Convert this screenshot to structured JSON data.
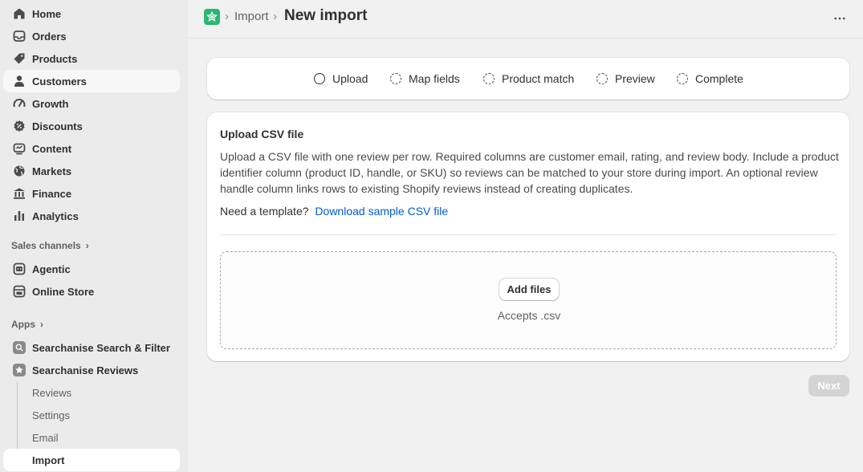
{
  "sidebar": {
    "items": [
      {
        "label": "Home",
        "icon": "home-icon"
      },
      {
        "label": "Orders",
        "icon": "orders-icon"
      },
      {
        "label": "Products",
        "icon": "tag-icon"
      },
      {
        "label": "Customers",
        "icon": "person-icon"
      },
      {
        "label": "Growth",
        "icon": "gauge-icon"
      },
      {
        "label": "Discounts",
        "icon": "discount-icon"
      },
      {
        "label": "Content",
        "icon": "content-icon"
      },
      {
        "label": "Markets",
        "icon": "globe-icon"
      },
      {
        "label": "Finance",
        "icon": "bank-icon"
      },
      {
        "label": "Analytics",
        "icon": "bar-chart-icon"
      }
    ],
    "sales_channels_label": "Sales channels",
    "sales_channels": [
      {
        "label": "Agentic",
        "icon": "agentic-icon"
      },
      {
        "label": "Online Store",
        "icon": "store-icon"
      }
    ],
    "apps_label": "Apps",
    "apps": [
      {
        "label": "Searchanise Search & Filter",
        "icon": "search-app-icon"
      },
      {
        "label": "Searchanise Reviews",
        "icon": "reviews-app-icon"
      }
    ],
    "app_subitems": [
      {
        "label": "Reviews"
      },
      {
        "label": "Settings"
      },
      {
        "label": "Email"
      },
      {
        "label": "Import"
      }
    ]
  },
  "header": {
    "breadcrumb": "Import",
    "title": "New import"
  },
  "stepper": {
    "steps": [
      "Upload",
      "Map fields",
      "Product match",
      "Preview",
      "Complete"
    ]
  },
  "upload": {
    "title": "Upload CSV file",
    "description": "Upload a CSV file with one review per row. Required columns are customer email, rating, and review body. Include a product identifier column (product ID, handle, or SKU) so reviews can be matched to your store during import. An optional review handle column links rows to existing Shopify reviews instead of creating duplicates.",
    "template_prompt": "Need a template?",
    "template_link": "Download sample CSV file",
    "add_files": "Add files",
    "accepts": "Accepts .csv"
  },
  "next_label": "Next",
  "colors": {
    "accent_link": "#005bd3",
    "app_logo": "#2bb673",
    "sidebar_bg": "#ebebeb",
    "page_bg": "#f1f1f1"
  }
}
